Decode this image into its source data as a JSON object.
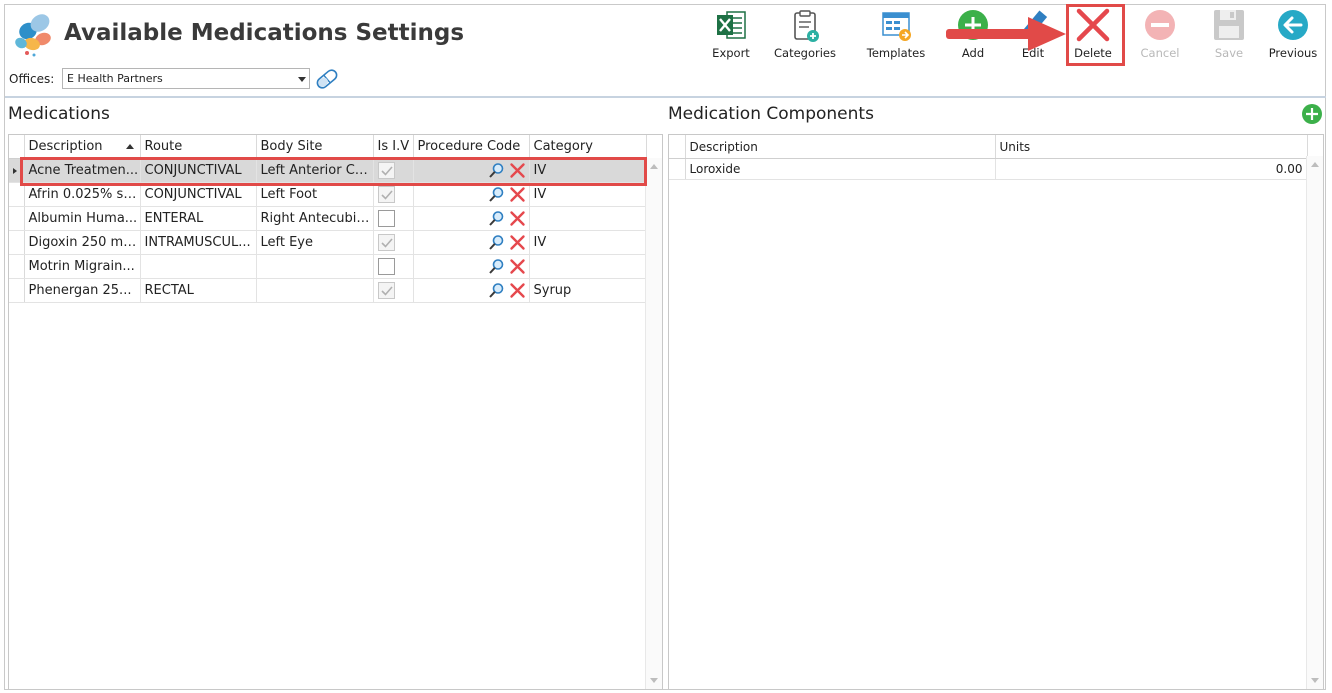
{
  "header": {
    "title": "Available Medications Settings",
    "offices_label": "Offices:",
    "office_value": "E Health Partners"
  },
  "toolbar": {
    "export": "Export",
    "categories": "Categories",
    "templates": "Templates",
    "add": "Add",
    "edit": "Edit",
    "delete": "Delete",
    "cancel": "Cancel",
    "save": "Save",
    "previous": "Previous"
  },
  "medications": {
    "title": "Medications",
    "columns": [
      "Description",
      "Route",
      "Body Site",
      "Is I.V",
      "Procedure Code",
      "Category"
    ],
    "rows": [
      {
        "description": "Acne Treatmen...",
        "route": "CONJUNCTIVAL",
        "body_site": "Left Anterior Ch...",
        "is_iv": true,
        "category": "IV"
      },
      {
        "description": "Afrin 0.025% so...",
        "route": "CONJUNCTIVAL",
        "body_site": "Left Foot",
        "is_iv": true,
        "category": "IV"
      },
      {
        "description": "Albumin Huma...",
        "route": "ENTERAL",
        "body_site": "Right Antecubit...",
        "is_iv": false,
        "category": ""
      },
      {
        "description": "Digoxin 250 mc...",
        "route": "INTRAMUSCUL...",
        "body_site": "Left Eye",
        "is_iv": true,
        "category": "IV"
      },
      {
        "description": "Motrin Migrain...",
        "route": "",
        "body_site": "",
        "is_iv": false,
        "category": ""
      },
      {
        "description": "Phenergan 25...",
        "route": "RECTAL",
        "body_site": "",
        "is_iv": true,
        "category": "Syrup"
      }
    ]
  },
  "components": {
    "title": "Medication Components",
    "columns": [
      "Description",
      "Units"
    ],
    "rows": [
      {
        "description": "Loroxide",
        "units": "0.00"
      }
    ]
  },
  "colors": {
    "highlight": "#e14a48",
    "selected_row": "#d9d9d9",
    "excel_green": "#1e7145",
    "add_green": "#3cb04a",
    "delete_red": "#e5484d",
    "previous_teal": "#27a9c6"
  }
}
